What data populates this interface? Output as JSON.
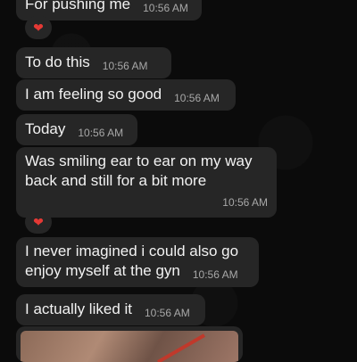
{
  "messages": [
    {
      "text": "For pushing me",
      "time": "10:56 AM"
    },
    {
      "text": "To do this",
      "time": "10:56 AM"
    },
    {
      "text": "I am feeling so good",
      "time": "10:56 AM"
    },
    {
      "text": "Today",
      "time": "10:56 AM"
    },
    {
      "text": "Was smiling ear to ear on my way back and still for a bit more",
      "time": "10:56 AM"
    },
    {
      "text": "I never imagined i could also go enjoy myself at the gyn",
      "time": "10:56 AM"
    },
    {
      "text": "I actually liked it",
      "time": "10:56 AM"
    }
  ],
  "reactions": [
    "heart",
    "heart"
  ],
  "colors": {
    "bubble": "#262626",
    "background": "#0b0b0b",
    "heart": "#e53935"
  }
}
